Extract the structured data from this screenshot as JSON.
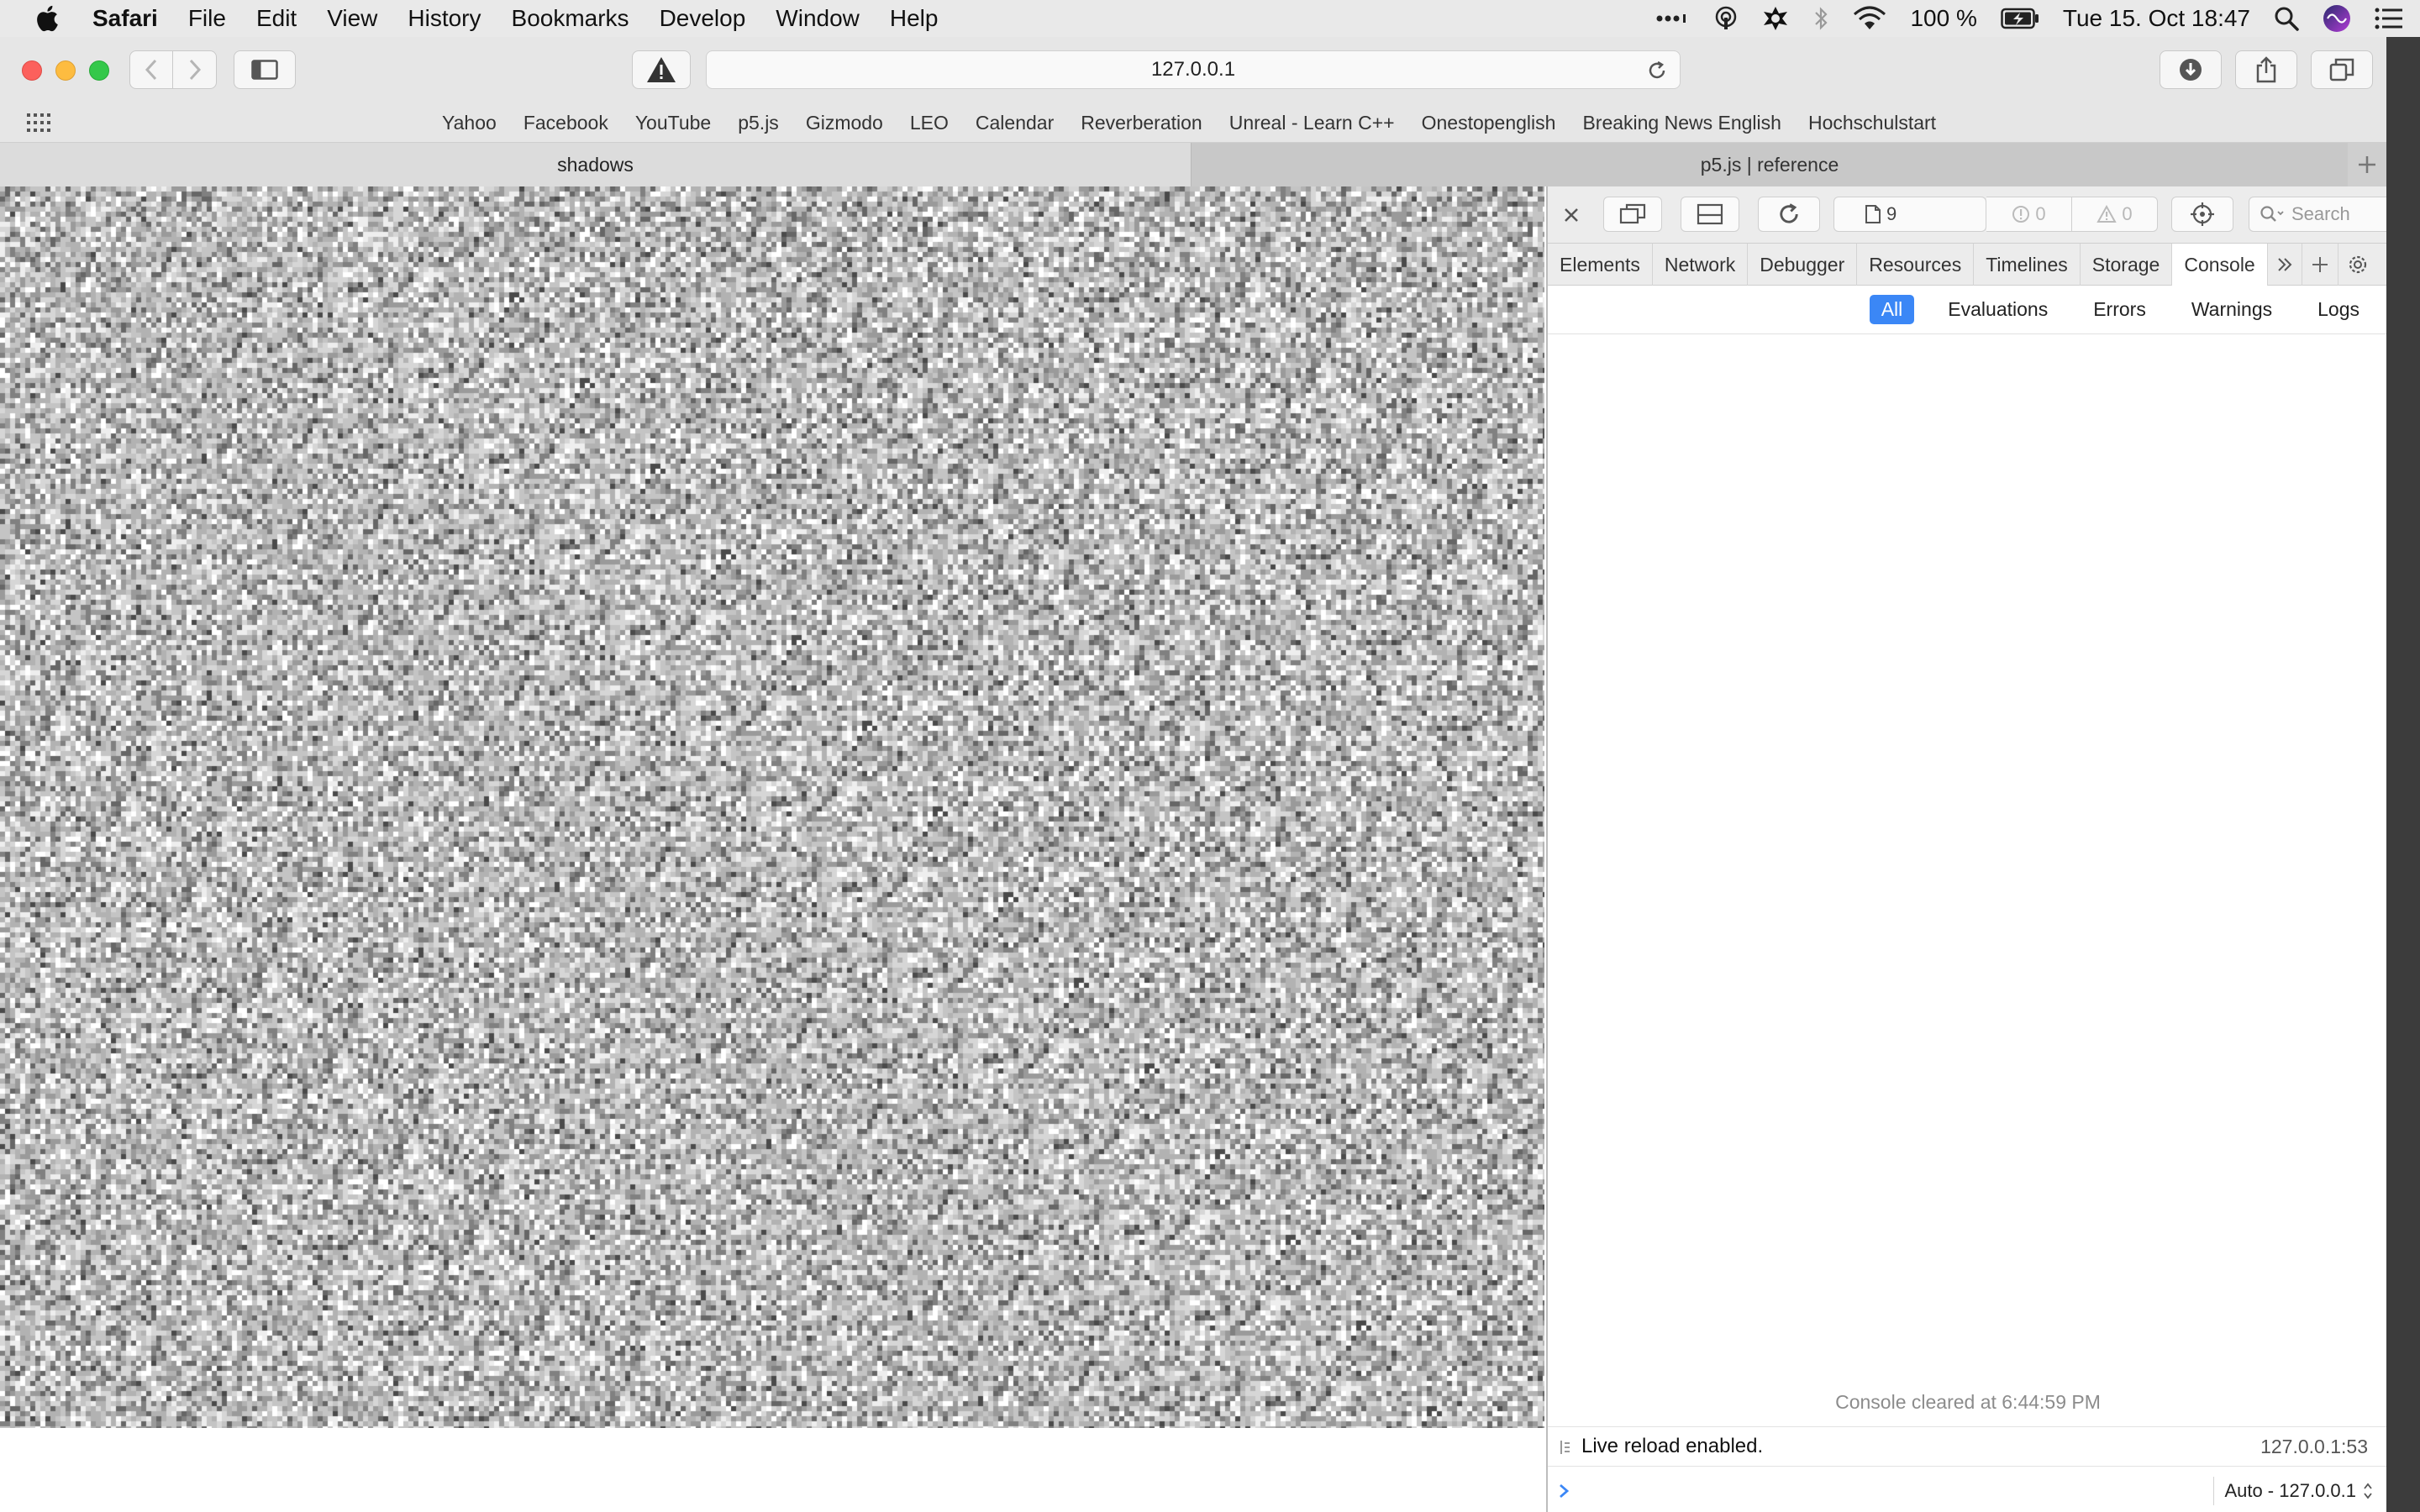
{
  "menubar": {
    "app": "Safari",
    "items": [
      "File",
      "Edit",
      "View",
      "History",
      "Bookmarks",
      "Develop",
      "Window",
      "Help"
    ],
    "battery": "100 %",
    "clock": "Tue 15. Oct  18:47"
  },
  "toolbar": {
    "address": "127.0.0.1"
  },
  "favorites": [
    "Yahoo",
    "Facebook",
    "YouTube",
    "p5.js",
    "Gizmodo",
    "LEO",
    "Calendar",
    "Reverberation",
    "Unreal - Learn C++",
    "Onestopenglish",
    "Breaking News English",
    "Hochschulstart"
  ],
  "tabs": {
    "active": "shadows",
    "inactive": "p5.js | reference"
  },
  "inspector": {
    "resource_count": "9",
    "error_count": "0",
    "warning_count": "0",
    "search_placeholder": "Search",
    "tabs": [
      "Elements",
      "Network",
      "Debugger",
      "Resources",
      "Timelines",
      "Storage",
      "Console"
    ],
    "filters": [
      "All",
      "Evaluations",
      "Errors",
      "Warnings",
      "Logs"
    ],
    "console": {
      "cleared": "Console cleared at 6:44:59 PM",
      "log_message": "Live reload enabled.",
      "log_source": "127.0.0.1:53",
      "context": "Auto - 127.0.0.1"
    }
  },
  "colors": {
    "accent": "#3b87f6",
    "close": "#fc605c",
    "minimize": "#fdbc40",
    "zoom": "#34c84a"
  }
}
